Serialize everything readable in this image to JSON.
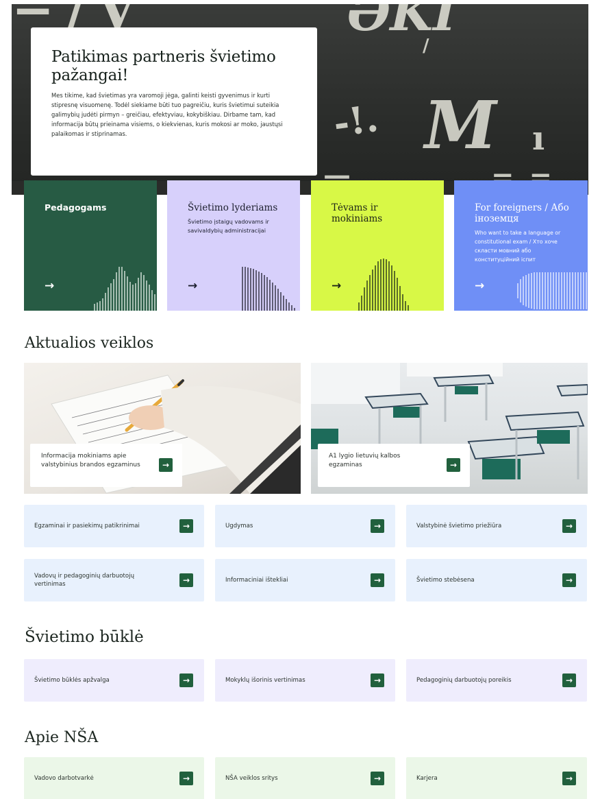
{
  "hero": {
    "title": "Patikimas partneris švietimo pažangai!",
    "text": "Mes tikime, kad švietimas yra varomoji jėga, galinti keisti gyvenimus ir kurti stipresnę visuomenę. Todėl siekiame būti tuo pagreičiu, kuris švietimui suteikia galimybių judėti pirmyn – greičiau, efektyviau, kokybiškiau. Dirbame tam, kad informacija būtų prieinama visiems, o kiekvienas, kuris mokosi ar moko, jaustųsi palaikomas ir stiprinamas."
  },
  "audiences": [
    {
      "title": "Pedagogams",
      "subtitle": "",
      "arrow": "→"
    },
    {
      "title": "Švietimo lyderiams",
      "subtitle": "Švietimo įstaigų vadovams ir savivaldybių administracijai",
      "arrow": "→"
    },
    {
      "title": "Tėvams ir mokiniams",
      "subtitle": "",
      "arrow": "→"
    },
    {
      "title": "For foreigners / Або іноземця",
      "subtitle": "Who want to take a language or constitutional exam / Хто хоче скласти мовний або конституційний іспит",
      "arrow": "→"
    }
  ],
  "sections": {
    "activities": "Aktualios veiklos",
    "status": "Švietimo būklė",
    "about": "Apie NŠA"
  },
  "features": [
    {
      "label": "Informacija mokiniams apie valstybinius brandos egzaminus"
    },
    {
      "label": "A1 lygio lietuvių kalbos egzaminas"
    }
  ],
  "activity_links": [
    "Egzaminai ir pasiekimų patikrinimai",
    "Ugdymas",
    "Valstybinė švietimo priežiūra",
    "Vadovų ir pedagoginių darbuotojų vertinimas",
    "Informaciniai ištekliai",
    "Švietimo stebėsena"
  ],
  "status_links": [
    "Švietimo būklės apžvalga",
    "Mokyklų išorinis vertinimas",
    "Pedagoginių darbuotojų poreikis"
  ],
  "about_links": [
    "Vadovo darbotvarkė",
    "NŠA veiklos sritys",
    "Karjera"
  ],
  "arrow": "→",
  "colors": {
    "pedagogams": "#275b44",
    "lyderiams": "#d7d0fb",
    "tevams": "#d8f846",
    "foreigners": "#6f8ff6",
    "button": "#21603d"
  }
}
